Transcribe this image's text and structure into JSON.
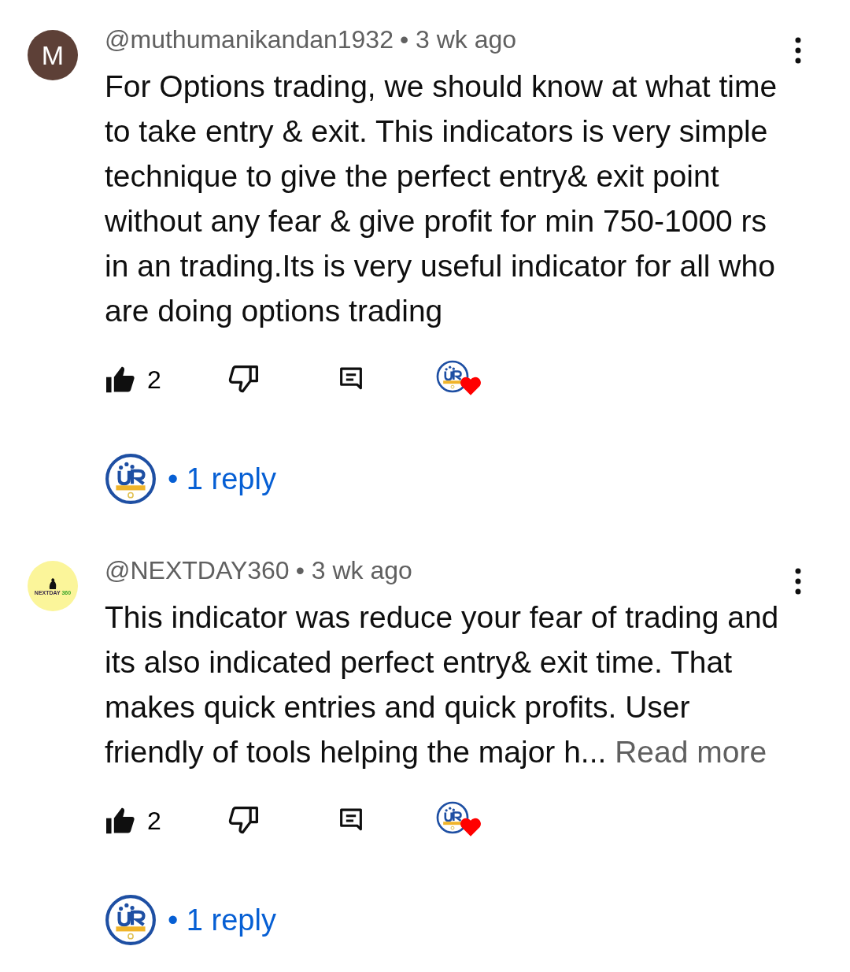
{
  "comments": [
    {
      "avatar": {
        "kind": "letter",
        "text": "M"
      },
      "author": "@muthumanikandan1932",
      "time": "• 3 wk ago",
      "lines": [
        "For Options trading, we should know at what time",
        "to take entry & exit. This indicators is very simple",
        "technique to give the perfect entry& exit point",
        "without any fear & give profit for min 750-1000 rs",
        "in an trading.Its is very useful indicator for all who",
        "are doing options trading"
      ],
      "likes": "2",
      "creator_hearted": true,
      "replies": "• 1 reply"
    },
    {
      "avatar": {
        "kind": "logo",
        "text": "NEXTDAY",
        "accent": "360"
      },
      "author": "@NEXTDAY360",
      "time": "• 3 wk ago",
      "lines": [
        "This indicator was reduce your fear of trading and",
        "its also indicated perfect entry& exit time. That",
        "makes quick entries and quick profits. User",
        "friendly of tools helping the major h..."
      ],
      "read_more": "Read more",
      "likes": "2",
      "creator_hearted": true,
      "replies": "• 1 reply"
    }
  ]
}
